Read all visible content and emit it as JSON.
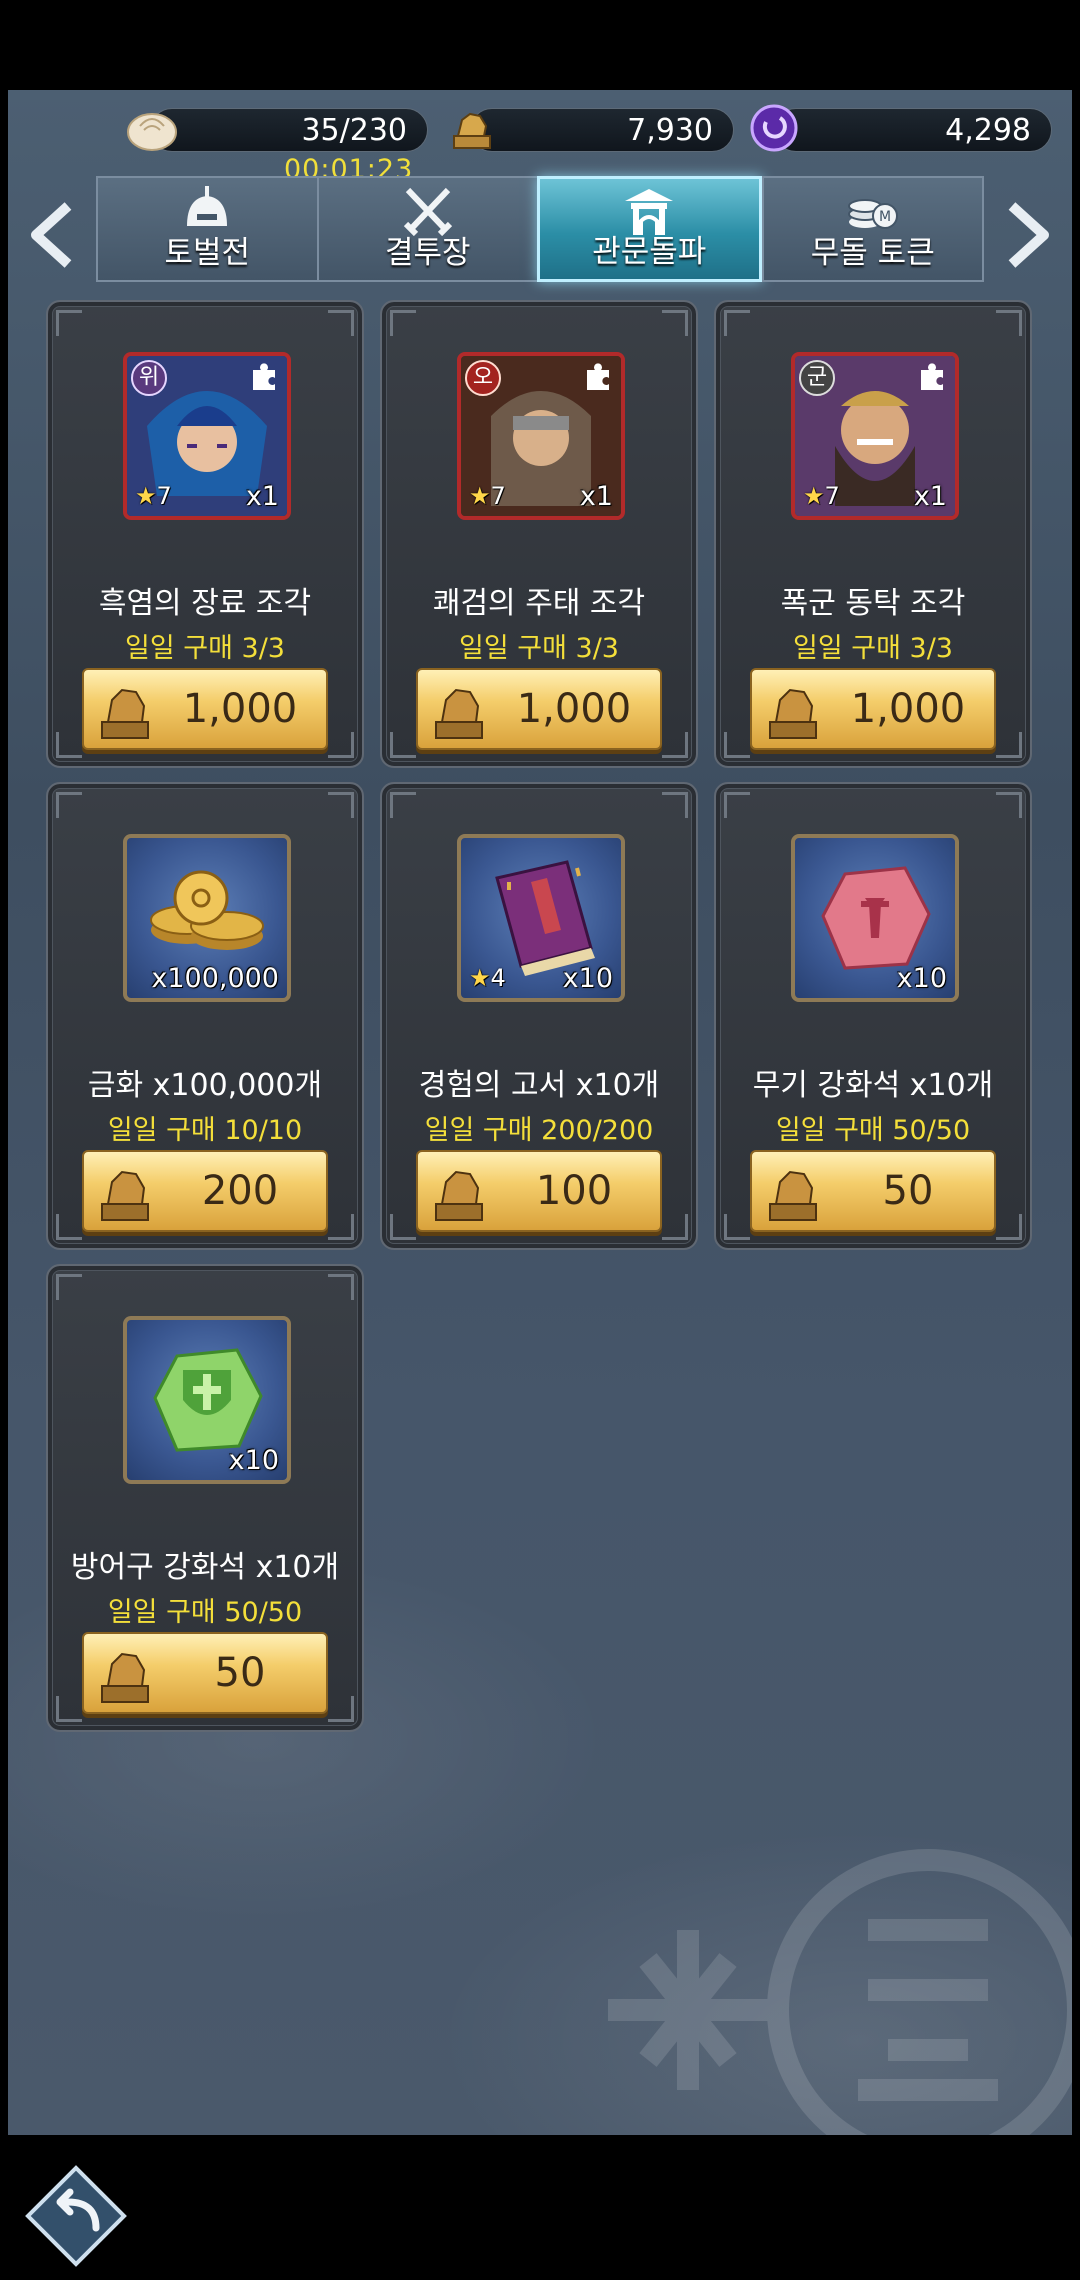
{
  "resources": {
    "stamina": "35/230",
    "stamina_timer": "00:01:23",
    "tokens": "7,930",
    "gems": "4,298"
  },
  "tabs": [
    {
      "label": "토벌전",
      "icon": "helmet-icon",
      "active": false
    },
    {
      "label": "결투장",
      "icon": "crossed-swords-icon",
      "active": false
    },
    {
      "label": "관문돌파",
      "icon": "gate-icon",
      "active": true
    },
    {
      "label": "무돌 토큰",
      "icon": "coins-icon",
      "active": false
    }
  ],
  "items": [
    {
      "name": "흑염의 장료 조각",
      "limit": "일일 구매 3/3",
      "price": "1,000",
      "faction": "위",
      "stars": "7",
      "qty": "x1",
      "kind": "hero"
    },
    {
      "name": "쾌검의 주태 조각",
      "limit": "일일 구매 3/3",
      "price": "1,000",
      "faction": "오",
      "stars": "7",
      "qty": "x1",
      "kind": "hero"
    },
    {
      "name": "폭군 동탁 조각",
      "limit": "일일 구매 3/3",
      "price": "1,000",
      "faction": "군",
      "stars": "7",
      "qty": "x1",
      "kind": "hero"
    },
    {
      "name": "금화 x100,000개",
      "limit": "일일 구매 10/10",
      "price": "200",
      "qty": "x100,000",
      "kind": "gold-coins"
    },
    {
      "name": "경험의 고서 x10개",
      "limit": "일일 구매 200/200",
      "price": "100",
      "stars": "4",
      "qty": "x10",
      "kind": "book"
    },
    {
      "name": "무기 강화석 x10개",
      "limit": "일일 구매 50/50",
      "price": "50",
      "qty": "x10",
      "kind": "weapon-stone"
    },
    {
      "name": "방어구 강화석 x10개",
      "limit": "일일 구매 50/50",
      "price": "50",
      "qty": "x10",
      "kind": "armor-stone"
    }
  ]
}
